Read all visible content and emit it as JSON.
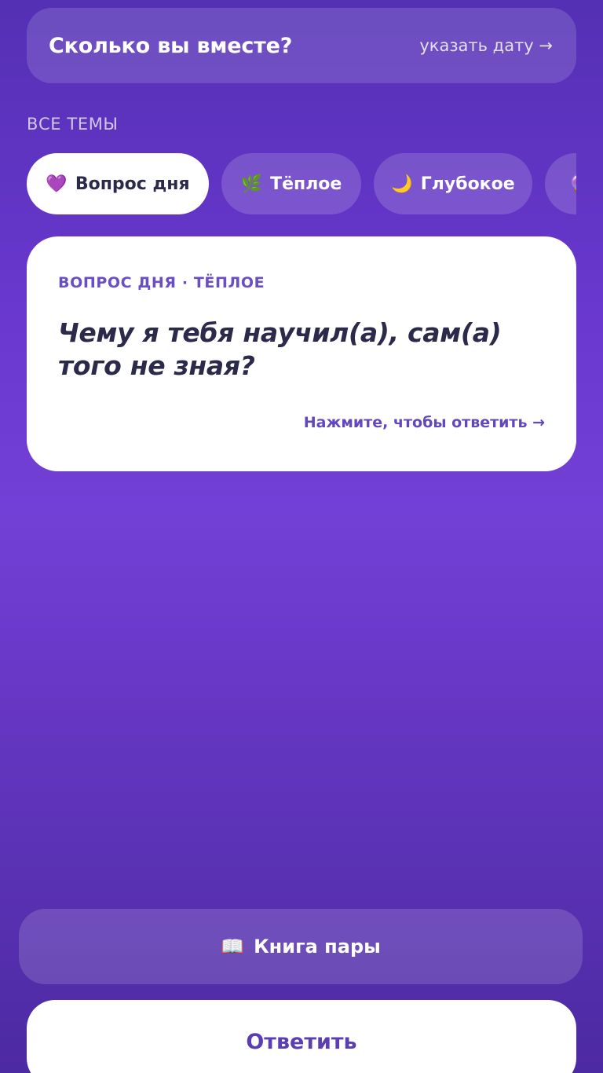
{
  "date_card": {
    "title": "Сколько вы вместе?",
    "action": "указать дату →"
  },
  "topics": {
    "section_label": "ВСЕ ТЕМЫ",
    "chips": [
      {
        "icon": "💜",
        "icon_name": "purple-heart-icon",
        "label": "Вопрос дня",
        "active": true
      },
      {
        "icon": "🌿",
        "icon_name": "herb-icon",
        "label": "Тёплое",
        "active": false
      },
      {
        "icon": "🌙",
        "icon_name": "crescent-moon-icon",
        "label": "Глубокое",
        "active": false
      },
      {
        "icon": "🔮",
        "icon_name": "partial-chip-icon",
        "label": "",
        "active": false
      }
    ]
  },
  "question_card": {
    "meta": "ВОПРОС ДНЯ · ТЁПЛОЕ",
    "question": "Чему я тебя научил(а), сам(а) того не зная?",
    "hint": "Нажмите, чтобы ответить →"
  },
  "buttons": {
    "book_icon": "📖",
    "book_label": "Книга пары",
    "answer_label": "Ответить"
  },
  "colors": {
    "background_top": "#5430b4",
    "background_mid": "#7340d6",
    "background_bottom": "#4c2aa3",
    "accent_text": "#6347bf",
    "question_text": "#2b2a4a"
  }
}
